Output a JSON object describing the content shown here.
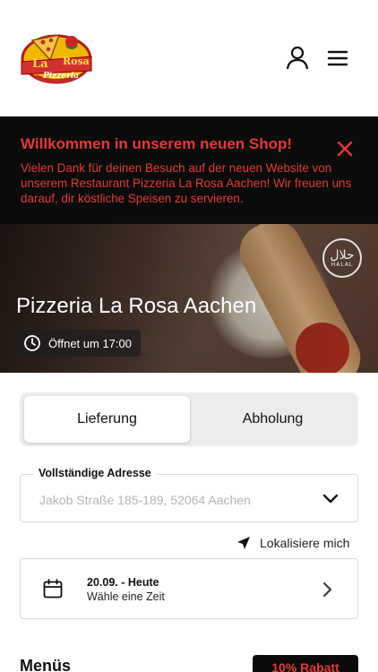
{
  "header": {
    "logo": {
      "text_top": "La",
      "text_mid": "Rosa",
      "text_sub": "Pizzeria"
    },
    "user_icon": "user-icon",
    "menu_icon": "hamburger-menu-icon"
  },
  "banner": {
    "title": "Willkommen in unserem neuen Shop!",
    "text": "Vielen Dank für deinen Besuch auf der neuen Website von unserem Restaurant Pizzeria La Rosa Aachen! Wir freuen uns darauf, dir köstliche Speisen zu servieren.",
    "close_icon": "close-icon",
    "color": "#e53935"
  },
  "hero": {
    "title": "Pizzeria La Rosa Aachen",
    "status": "Öffnet um 17:00",
    "clock_icon": "clock-icon",
    "badge_ar": "حلال",
    "badge_en": "HALAL"
  },
  "order_mode": {
    "delivery": "Lieferung",
    "pickup": "Abholung",
    "selected": "delivery"
  },
  "address": {
    "label": "Vollständige Adresse",
    "value": "Jakob Straße 185-189, 52064 Aachen"
  },
  "locate": {
    "label": "Lokalisiere mich",
    "icon": "location-arrow-icon"
  },
  "time": {
    "date": "20.09. - Heute",
    "sub": "Wähle eine Zeit",
    "icon": "calendar-icon"
  },
  "section": {
    "title": "Menüs",
    "badge": "10% Rabatt"
  }
}
